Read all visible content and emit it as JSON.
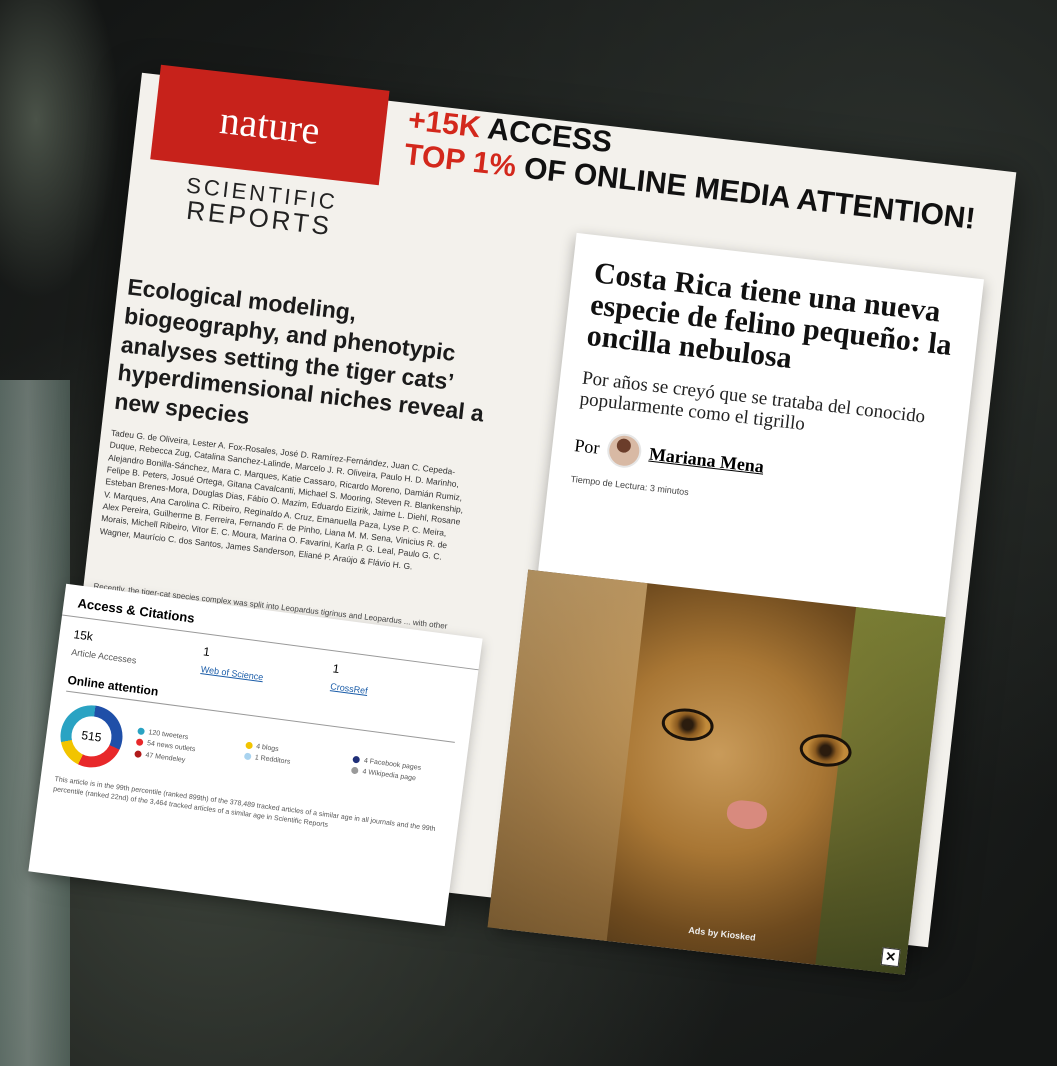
{
  "poster": {
    "brand": {
      "nature": "nature",
      "scientific": "SCIENTIFIC",
      "reports": "REPORTS"
    },
    "headline": {
      "line1_accent": "+15K",
      "line1_rest": " ACCESS",
      "line2_accent": "TOP 1%",
      "line2_rest": " OF ONLINE MEDIA ATTENTION!"
    },
    "paper_title": "Ecological modeling, biogeography, and phenotypic analyses setting the tiger cats’ hyperdimensional niches reveal a new species",
    "authors": "Tadeu G. de Oliveira, Lester A. Fox-Rosales, José D. Ramírez-Fernández, Juan C. Cepeda-Duque, Rebecca Zug, Catalina Sanchez-Lalinde, Marcelo J. R. Oliveira, Paulo H. D. Marinho, Alejandro Bonilla-Sánchez, Mara C. Marques, Katie Cassaro, Ricardo Moreno, Damián Rumiz, Felipe B. Peters, Josué Ortega, Gitana Cavalcanti, Michael S. Mooring, Steven R. Blankenship, Esteban Brenes-Mora, Douglas Dias, Fábio O. Mazim, Eduardo Eizirik, Jaime L. Diehl, Rosane V. Marques, Ana Carolina C. Ribeiro, Reginaldo A. Cruz, Emanuella Paza, Lyse P. C. Meira, Alex Pereira, Guilherme B. Ferreira, Fernando F. de Pinho, Liana M. M. Sena, Vinicius R. de Morais, Michell Ribeiro, Vitor E. C. Moura, Marina O. Favarini, Karla P. G. Leal, Paulo G. C. Wagner, Maurício C. dos Santos, James Sanderson, Eliané P. Araújo & Flávio H. G.",
    "abstract": "Recently, the tiger-cat species complex was split into Leopardus tigrinus and Leopardus ... with other proposed schemes. We performed a detailed analysis integrating ecological ... ecography, and phenotype of the four originally recognized subspecies—tigrinus, ... presented a new multidimensional niche depiction of the ... and photographs, all checked ... museum archives."
  },
  "metrics_card": {
    "title": "Access & Citations",
    "accesses_value": "15k",
    "accesses_label": "Article Accesses",
    "wos_value": "1",
    "wos_label": "Web of Science",
    "crossref_value": "1",
    "crossref_label": "CrossRef",
    "attention_title": "Online attention",
    "score": "515",
    "legend": [
      {
        "label": "120 tweeters",
        "color": "#2aa3c3"
      },
      {
        "label": "4 blogs",
        "color": "#f2c400"
      },
      {
        "label": "4 Facebook pages",
        "color": "#1f2f78"
      },
      {
        "label": "54 news outlets",
        "color": "#e8282a"
      },
      {
        "label": "1 Redditors",
        "color": "#a9d3ef"
      },
      {
        "label": "4 Wikipedia page",
        "color": "#9a9a9a"
      },
      {
        "label": "47 Mendeley",
        "color": "#b01a1a"
      }
    ],
    "footnote": "This article is in the 99th percentile (ranked 899th) of the 378,489 tracked articles of a similar age in all journals and the 99th percentile (ranked 22nd) of the 3,464 tracked articles of a similar age in Scientific Reports"
  },
  "article": {
    "title": "Costa Rica tiene una nueva especie de felino pequeño: la oncilla nebulosa",
    "subtitle": "Por años se creyó que se trataba del conocido popularmente como el tigrillo",
    "by": "Por",
    "author": "Mariana Mena",
    "reading_time": "Tiempo de Lectura: 3 minutos",
    "ads": "Ads by Kiosked",
    "close": "✕"
  }
}
